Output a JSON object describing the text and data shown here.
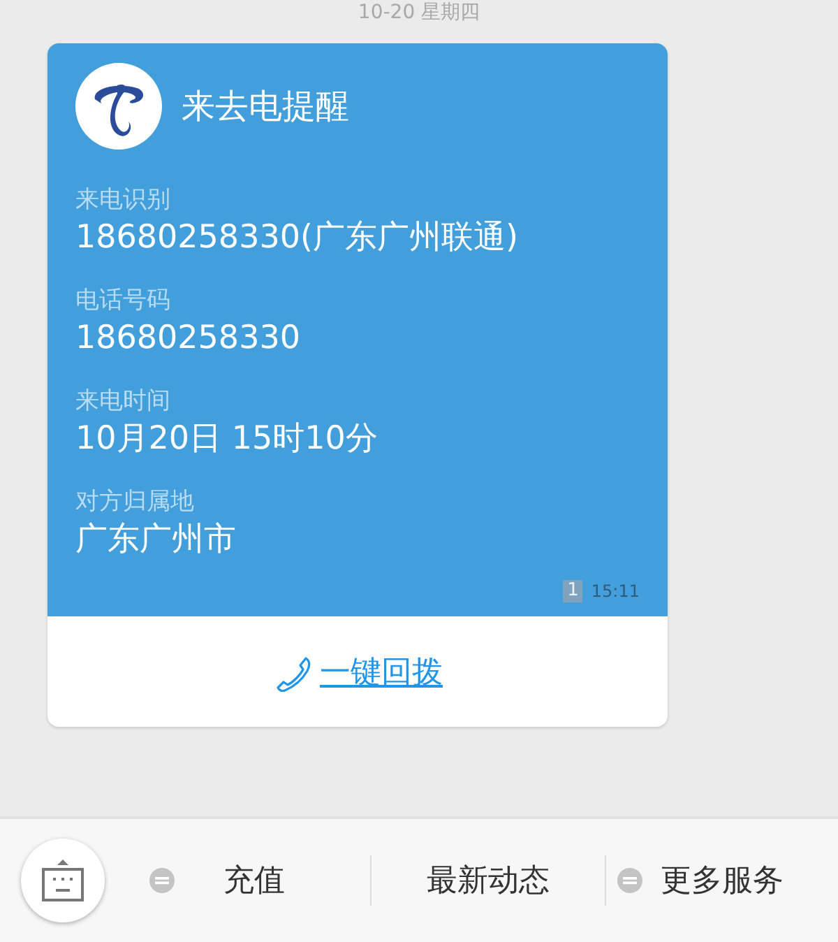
{
  "date_header": "10-20  星期四",
  "card": {
    "title": "来去电提醒",
    "fields": [
      {
        "label": "来电识别",
        "value": "18680258330(广东广州联通)"
      },
      {
        "label": "电话号码",
        "value": "18680258330"
      },
      {
        "label": "来电时间",
        "value": "10月20日 15时10分"
      },
      {
        "label": "对方归属地",
        "value": "广东广州市"
      }
    ],
    "badge": "1",
    "time": "15:11",
    "action": "一键回拨"
  },
  "menu": [
    {
      "label": "充值",
      "has_submenu": true
    },
    {
      "label": "最新动态",
      "has_submenu": false
    },
    {
      "label": "更多服务",
      "has_submenu": true
    }
  ]
}
